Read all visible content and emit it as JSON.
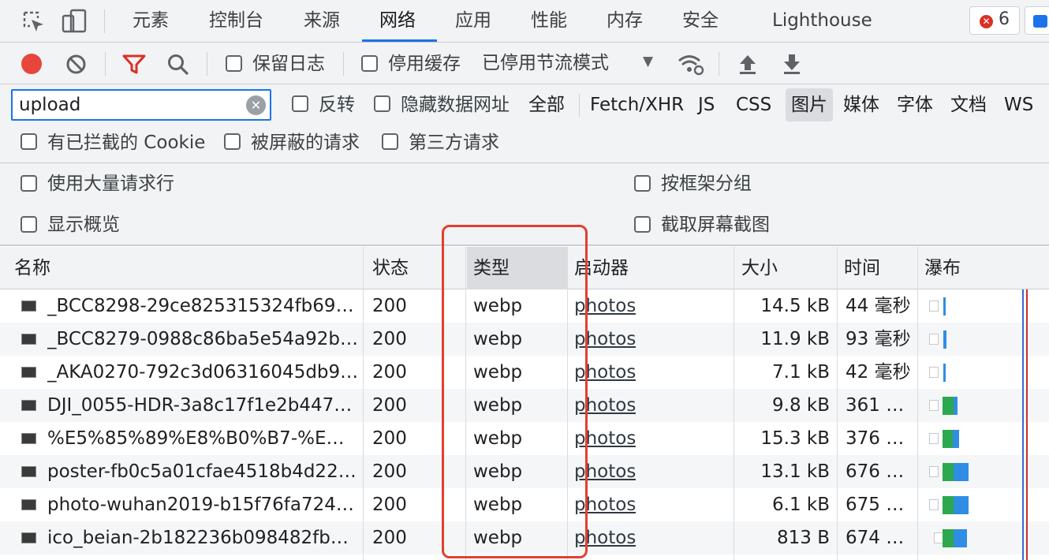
{
  "tabs": [
    "元素",
    "控制台",
    "来源",
    "网络",
    "应用",
    "性能",
    "内存",
    "安全",
    "Lighthouse"
  ],
  "error_count": "6",
  "toolbar": {
    "preserve_log": "保留日志",
    "disable_cache": "停用缓存",
    "throttling": "已停用节流模式"
  },
  "filter": {
    "search_value": "upload",
    "invert": "反转",
    "hide_data_urls": "隐藏数据网址",
    "types": [
      "全部",
      "Fetch/XHR",
      "JS",
      "CSS",
      "图片",
      "媒体",
      "字体",
      "文档",
      "WS"
    ],
    "selected_type": "图片",
    "blocked_cookies": "有已拦截的 Cookie",
    "blocked_requests": "被屏蔽的请求",
    "third_party": "第三方请求"
  },
  "settings": {
    "large_rows": "使用大量请求行",
    "group_by_frame": "按框架分组",
    "show_overview": "显示概览",
    "capture_screenshots": "截取屏幕截图"
  },
  "table": {
    "headers": [
      "名称",
      "状态",
      "类型",
      "启动器",
      "大小",
      "时间",
      "瀑布"
    ],
    "rows": [
      {
        "name": "_BCC8298-29ce825315324fb698…",
        "status": "200",
        "type": "webp",
        "initiator": "photos",
        "size": "14.5 kB",
        "time": "44 毫秒"
      },
      {
        "name": "_BCC8279-0988c86ba5e54a92b6…",
        "status": "200",
        "type": "webp",
        "initiator": "photos",
        "size": "11.9 kB",
        "time": "93 毫秒"
      },
      {
        "name": "_AKA0270-792c3d06316045db9a…",
        "status": "200",
        "type": "webp",
        "initiator": "photos",
        "size": "7.1 kB",
        "time": "42 毫秒"
      },
      {
        "name": "DJI_0055-HDR-3a8c17f1e2b4470…",
        "status": "200",
        "type": "webp",
        "initiator": "photos",
        "size": "9.8 kB",
        "time": "361 …"
      },
      {
        "name": "%E5%85%89%E8%B0%B7-%E…",
        "status": "200",
        "type": "webp",
        "initiator": "photos",
        "size": "15.3 kB",
        "time": "376 …"
      },
      {
        "name": "poster-fb0c5a01cfae4518b4d22c…",
        "status": "200",
        "type": "webp",
        "initiator": "photos",
        "size": "13.1 kB",
        "time": "676 …"
      },
      {
        "name": "photo-wuhan2019-b15f76fa72404…",
        "status": "200",
        "type": "webp",
        "initiator": "photos",
        "size": "6.1 kB",
        "time": "675 …"
      },
      {
        "name": "ico_beian-2b182236b098482fba2…",
        "status": "200",
        "type": "webp",
        "initiator": "photos",
        "size": "813 B",
        "time": "674 …"
      }
    ]
  },
  "colors": {
    "accent": "#1a73e8",
    "highlight": "#e2402f",
    "record": "#e8453c",
    "filter_active": "#d93025"
  }
}
